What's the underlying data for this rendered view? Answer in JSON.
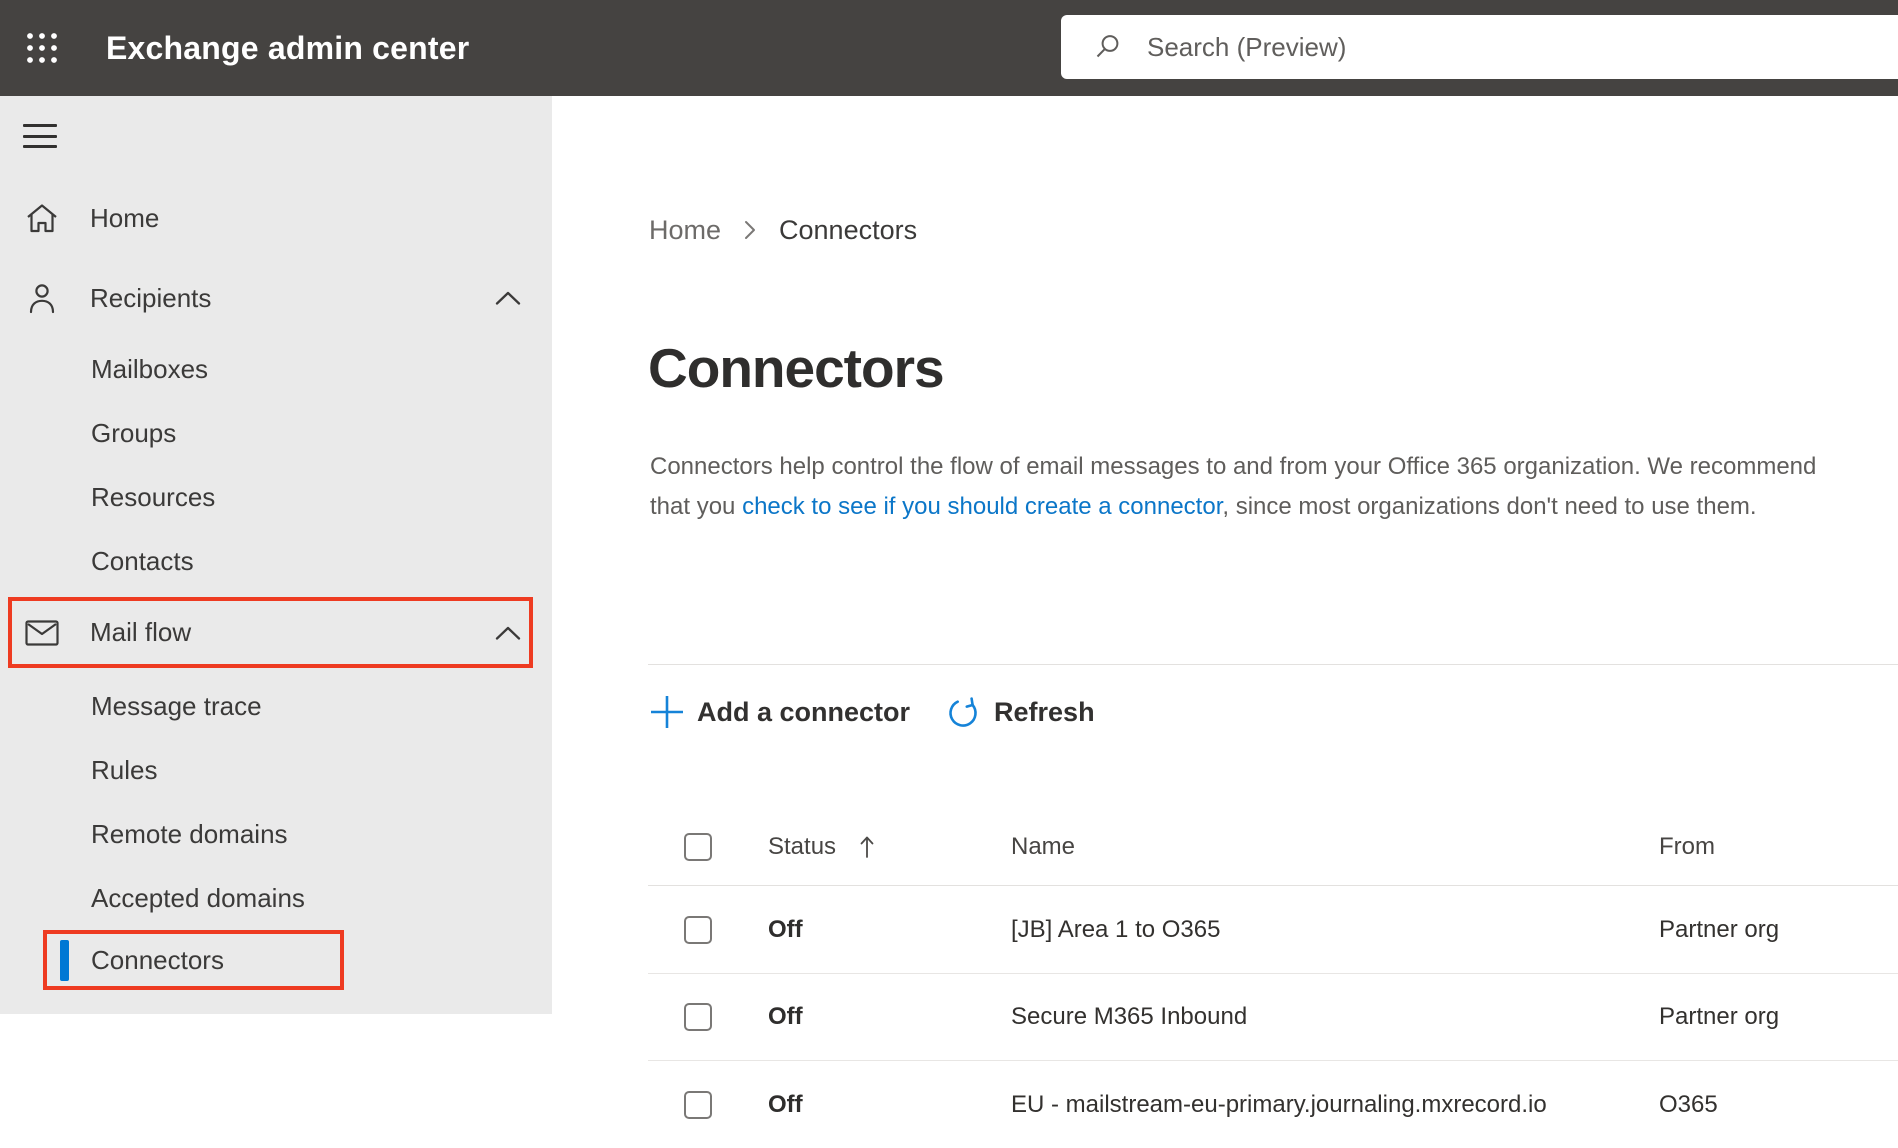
{
  "topbar": {
    "app_title": "Exchange admin center",
    "search_placeholder": "Search (Preview)"
  },
  "sidebar": {
    "items": [
      {
        "label": "Home",
        "icon": "home",
        "level": 1
      },
      {
        "label": "Recipients",
        "icon": "person",
        "level": 1,
        "expanded": true
      },
      {
        "label": "Mailboxes",
        "level": 2
      },
      {
        "label": "Groups",
        "level": 2
      },
      {
        "label": "Resources",
        "level": 2
      },
      {
        "label": "Contacts",
        "level": 2
      },
      {
        "label": "Mail flow",
        "icon": "mail",
        "level": 1,
        "expanded": true,
        "annotated": true
      },
      {
        "label": "Message trace",
        "level": 2
      },
      {
        "label": "Rules",
        "level": 2
      },
      {
        "label": "Remote domains",
        "level": 2
      },
      {
        "label": "Accepted domains",
        "level": 2
      },
      {
        "label": "Connectors",
        "level": 2,
        "selected": true,
        "annotated": true
      }
    ]
  },
  "breadcrumb": {
    "home": "Home",
    "current": "Connectors"
  },
  "page": {
    "title": "Connectors",
    "desc_before": "Connectors help control the flow of email messages to and from your Office 365 organization. We recommend that you ",
    "desc_link": "check to see if you should create a connector",
    "desc_after": ", since most organizations don't need to use them."
  },
  "toolbar": {
    "add": "Add a connector",
    "refresh": "Refresh"
  },
  "table": {
    "headers": {
      "status": "Status",
      "name": "Name",
      "from": "From"
    },
    "sort": {
      "column": "Status",
      "direction": "ascending"
    },
    "rows": [
      {
        "status": "Off",
        "name": "[JB] Area 1 to O365",
        "from": "Partner org"
      },
      {
        "status": "Off",
        "name": "Secure M365 Inbound",
        "from": "Partner org"
      },
      {
        "status": "Off",
        "name": "EU - mailstream-eu-primary.journaling.mxrecord.io",
        "from": "O365"
      }
    ]
  },
  "colors": {
    "topbar_bg": "#454341",
    "sidebar_bg": "#eaeaea",
    "accent_blue": "#0078d4",
    "link_blue": "#0b76c8",
    "icon_blue": "#1583d8",
    "annotation_red": "#ee3b21",
    "text_primary": "#323130",
    "text_secondary": "#605e5c"
  }
}
